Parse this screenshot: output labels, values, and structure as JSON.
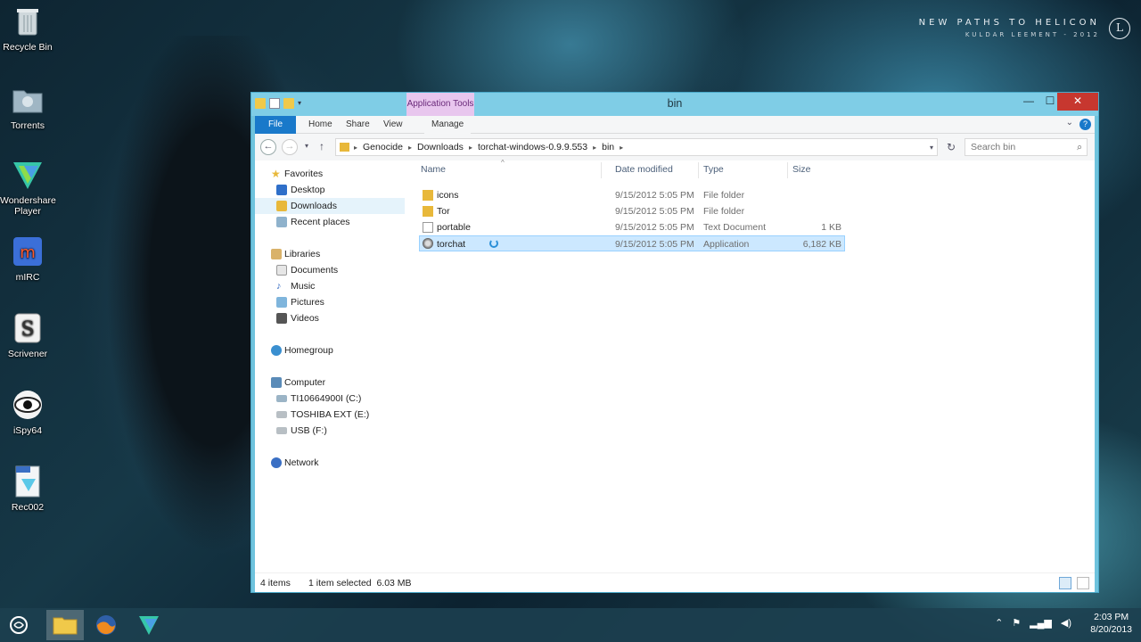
{
  "wallpaper": {
    "title_line1": "NEW PATHS TO HELICON",
    "title_line2": "KULDAR LEEMENT - 2012",
    "logo_letter": "L"
  },
  "desktop_icons": [
    {
      "label": "Recycle Bin",
      "icon": "recycle-bin-icon"
    },
    {
      "label": "Torrents",
      "icon": "folder-icon"
    },
    {
      "label": "Wondershare Player",
      "icon": "wondershare-icon"
    },
    {
      "label": "mIRC",
      "icon": "mirc-icon"
    },
    {
      "label": "Scrivener",
      "icon": "scrivener-icon"
    },
    {
      "label": "iSpy64",
      "icon": "eye-icon"
    },
    {
      "label": "Rec002",
      "icon": "avi-file-icon"
    }
  ],
  "window": {
    "title": "bin",
    "context_tab_group": "Application Tools",
    "ribbon_tabs": [
      "File",
      "Home",
      "Share",
      "View",
      "Manage"
    ],
    "colors": {
      "file_tab": "#1979ca",
      "context_tab": "#e8c6ee",
      "selection": "#cce8ff",
      "close": "#c7372f"
    }
  },
  "address": {
    "crumbs": [
      "Genocide",
      "Downloads",
      "torchat-windows-0.9.9.553",
      "bin"
    ],
    "search_placeholder": "Search bin"
  },
  "nav": {
    "favorites_label": "Favorites",
    "favorites": [
      "Desktop",
      "Downloads",
      "Recent places"
    ],
    "libraries_label": "Libraries",
    "libraries": [
      "Documents",
      "Music",
      "Pictures",
      "Videos"
    ],
    "homegroup": "Homegroup",
    "computer_label": "Computer",
    "drives": [
      "TI10664900I (C:)",
      "TOSHIBA EXT (E:)",
      "USB (F:)"
    ],
    "network": "Network",
    "selected": "Downloads"
  },
  "columns": {
    "name": "Name",
    "date": "Date modified",
    "type": "Type",
    "size": "Size"
  },
  "files": [
    {
      "name": "icons",
      "date": "9/15/2012 5:05 PM",
      "type": "File folder",
      "size": "",
      "icon": "folder-icon"
    },
    {
      "name": "Tor",
      "date": "9/15/2012 5:05 PM",
      "type": "File folder",
      "size": "",
      "icon": "folder-icon"
    },
    {
      "name": "portable",
      "date": "9/15/2012 5:05 PM",
      "type": "Text Document",
      "size": "1 KB",
      "icon": "text-file-icon"
    },
    {
      "name": "torchat",
      "date": "9/15/2012 5:05 PM",
      "type": "Application",
      "size": "6,182 KB",
      "icon": "application-icon",
      "selected": true
    }
  ],
  "status": {
    "count": "4 items",
    "selection": "1 item selected  6.03 MB"
  },
  "taskbar": {
    "pinned": [
      "start-icon",
      "file-explorer-icon",
      "firefox-icon",
      "wondershare-icon"
    ],
    "time": "2:03 PM",
    "date": "8/20/2013"
  }
}
